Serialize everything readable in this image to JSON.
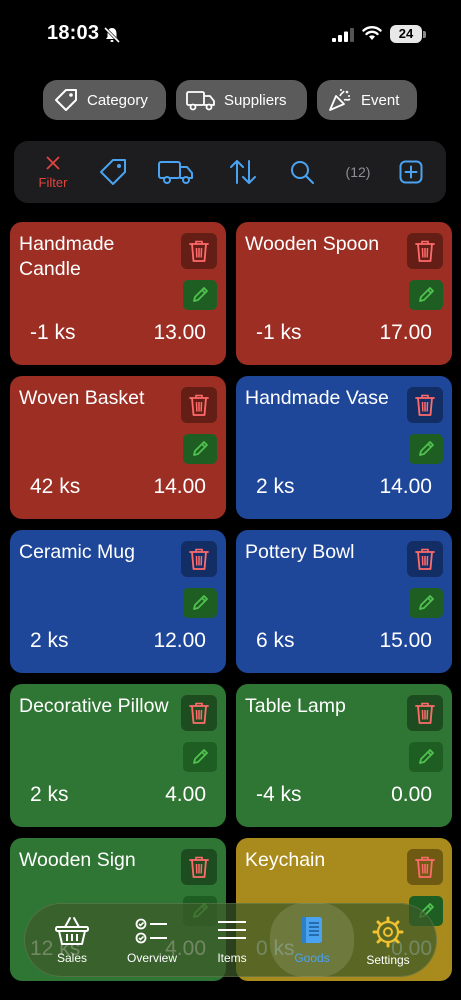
{
  "status_bar": {
    "time": "18:03",
    "battery": "24"
  },
  "chips": [
    {
      "label": "Category",
      "icon": "tag-icon"
    },
    {
      "label": "Suppliers",
      "icon": "truck-icon"
    },
    {
      "label": "Event",
      "icon": "party-popper-icon"
    }
  ],
  "toolbar": {
    "filter_label": "Filter",
    "count": "(12)"
  },
  "items": [
    {
      "name": "Handmade Candle",
      "qty": "-1 ks",
      "price": "13.00",
      "color": "#9c2e23"
    },
    {
      "name": "Wooden Spoon",
      "qty": "-1 ks",
      "price": "17.00",
      "color": "#9c2e23"
    },
    {
      "name": "Woven Basket",
      "qty": "42 ks",
      "price": "14.00",
      "color": "#9c2e23"
    },
    {
      "name": "Handmade Vase",
      "qty": "2 ks",
      "price": "14.00",
      "color": "#1e479a"
    },
    {
      "name": "Ceramic Mug",
      "qty": "2 ks",
      "price": "12.00",
      "color": "#1e479a"
    },
    {
      "name": "Pottery Bowl",
      "qty": "6 ks",
      "price": "15.00",
      "color": "#1e479a"
    },
    {
      "name": "Decorative Pillow",
      "qty": "2 ks",
      "price": "4.00",
      "color": "#2f7533"
    },
    {
      "name": "Table Lamp",
      "qty": "-4 ks",
      "price": "0.00",
      "color": "#2f7533"
    },
    {
      "name": "Wooden Sign",
      "qty": "12 ks",
      "price": "4.00",
      "color": "#2f7533"
    },
    {
      "name": "Keychain",
      "qty": "0 ks",
      "price": "0.00",
      "color": "#a98a1c"
    }
  ],
  "tabs": [
    {
      "label": "Sales",
      "icon": "basket-icon"
    },
    {
      "label": "Overview",
      "icon": "checklist-icon"
    },
    {
      "label": "Items",
      "icon": "list-icon"
    },
    {
      "label": "Goods",
      "icon": "book-icon",
      "active": true
    },
    {
      "label": "Settings",
      "icon": "gear-icon"
    }
  ],
  "colors": {
    "accent": "#4aa3f0",
    "filter_red": "#e0463e",
    "edit_green": "#4fc24f"
  }
}
